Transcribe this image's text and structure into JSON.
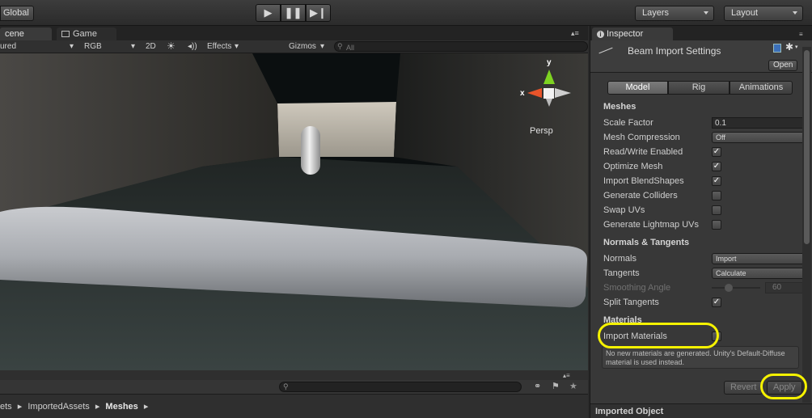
{
  "toolbar": {
    "global": "Global",
    "layers": "Layers",
    "layout": "Layout"
  },
  "scene": {
    "tab_scene": "cene",
    "tab_game": "Game",
    "shading": "ured",
    "rgb": "RGB",
    "mode_2d": "2D",
    "effects": "Effects",
    "gizmos": "Gizmos",
    "search_placeholder": "All",
    "gizmo_y": "y",
    "gizmo_x": "x",
    "persp": "Persp"
  },
  "project": {
    "breadcrumb": [
      "ets",
      "ImportedAssets",
      "Meshes"
    ]
  },
  "inspector": {
    "tab": "Inspector",
    "title": "Beam Import Settings",
    "open_button": "Open",
    "tabs": [
      "Model",
      "Rig",
      "Animations"
    ],
    "selected_tab": "Model",
    "meshes_header": "Meshes",
    "scale_factor_label": "Scale Factor",
    "scale_factor_value": "0.1",
    "mesh_compression_label": "Mesh Compression",
    "mesh_compression_value": "Off",
    "read_write_label": "Read/Write Enabled",
    "read_write_checked": true,
    "optimize_mesh_label": "Optimize Mesh",
    "optimize_mesh_checked": true,
    "blendshapes_label": "Import BlendShapes",
    "blendshapes_checked": true,
    "colliders_label": "Generate Colliders",
    "colliders_checked": false,
    "swap_uvs_label": "Swap UVs",
    "swap_uvs_checked": false,
    "lightmap_label": "Generate Lightmap UVs",
    "lightmap_checked": false,
    "normals_header": "Normals & Tangents",
    "normals_label": "Normals",
    "normals_value": "Import",
    "tangents_label": "Tangents",
    "tangents_value": "Calculate",
    "smoothing_label": "Smoothing Angle",
    "smoothing_value": "60",
    "split_tangents_label": "Split Tangents",
    "split_tangents_checked": true,
    "materials_header": "Materials",
    "import_materials_label": "Import Materials",
    "import_materials_checked": false,
    "help_text": "No new materials are generated. Unity's Default-Diffuse material is used instead.",
    "revert_button": "Revert",
    "apply_button": "Apply",
    "imported_object": "Imported Object"
  },
  "colors": {
    "highlight": "#f5f200",
    "panel_bg": "#383838",
    "toolbar_bg": "#2b2b2b"
  }
}
